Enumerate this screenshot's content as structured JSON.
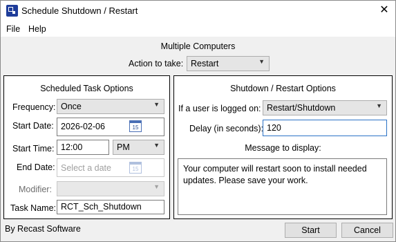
{
  "window": {
    "title": "Schedule Shutdown / Restart",
    "close_glyph": "✕"
  },
  "menu": {
    "file": "File",
    "help": "Help"
  },
  "header": {
    "heading": "Multiple Computers",
    "action_label": "Action to take:",
    "action_value": "Restart"
  },
  "scheduled": {
    "title": "Scheduled Task Options",
    "frequency_label": "Frequency:",
    "frequency_value": "Once",
    "start_date_label": "Start Date:",
    "start_date_value": "2026-02-06",
    "calendar_day": "15",
    "start_time_label": "Start Time:",
    "start_time_value": "12:00",
    "ampm_value": "PM",
    "end_date_label": "End Date:",
    "end_date_placeholder": "Select a date",
    "modifier_label": "Modifier:",
    "modifier_value": "",
    "task_name_label": "Task Name:",
    "task_name_value": "RCT_Sch_Shutdown"
  },
  "shutdown": {
    "title": "Shutdown / Restart Options",
    "logged_on_label": "If a user is logged on:",
    "logged_on_value": "Restart/Shutdown",
    "delay_label": "Delay (in seconds):",
    "delay_value": "120",
    "message_label": "Message to display:",
    "message_text": "Your computer will restart soon to install needed updates. Please save your work."
  },
  "footer": {
    "brand": "By Recast Software",
    "start": "Start",
    "cancel": "Cancel"
  },
  "icons": {
    "app": "app-icon",
    "close": "close-icon",
    "calendar": "calendar-icon",
    "dropdown": "chevron-down-icon"
  },
  "colors": {
    "window_bg": "#f0f0f0",
    "focus_border": "#2a72c6",
    "app_icon": "#1f3d9a"
  }
}
